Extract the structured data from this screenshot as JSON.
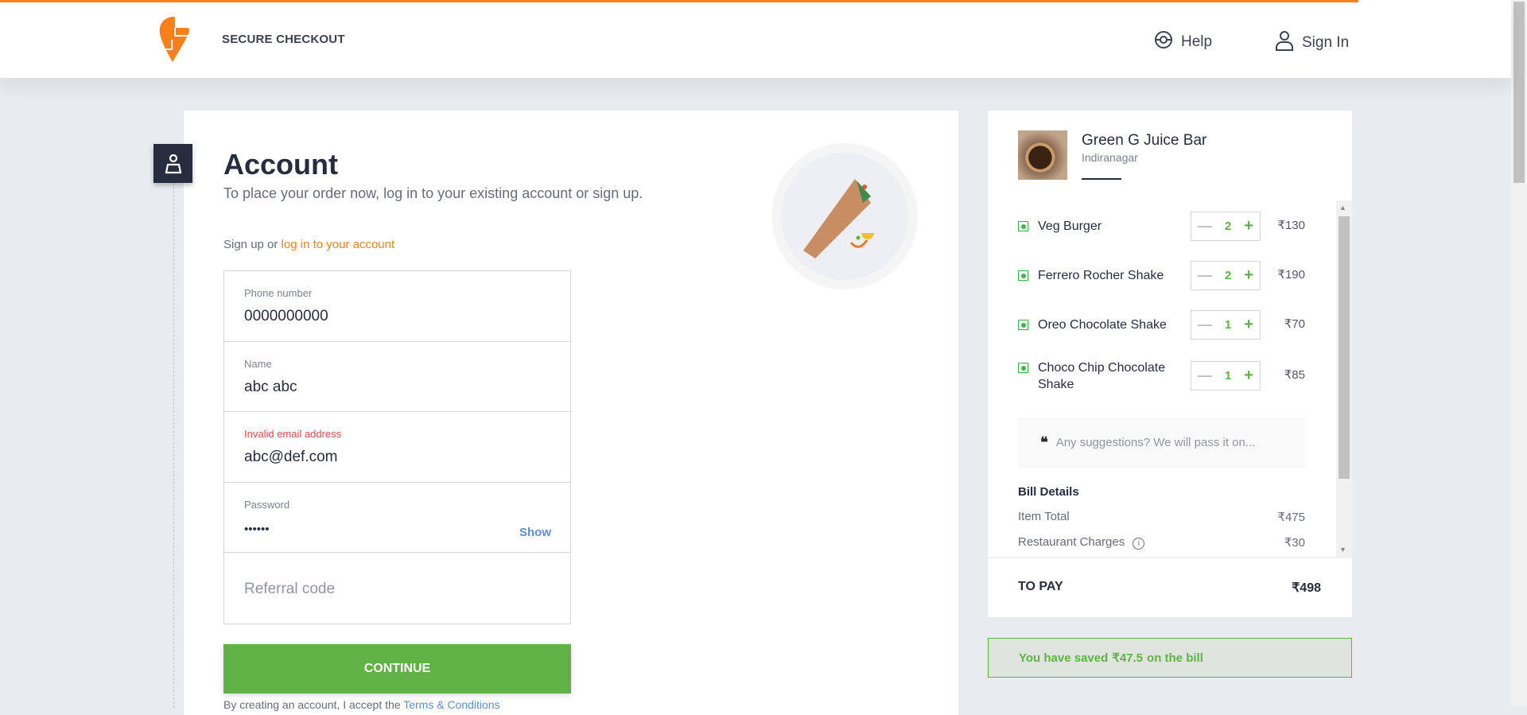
{
  "header": {
    "brand": "SECURE CHECKOUT",
    "help": "Help",
    "sign_in": "Sign In"
  },
  "account": {
    "title": "Account",
    "subtitle": "To place your order now, log in to your existing account or sign up.",
    "signup_prefix": "Sign up or ",
    "login_link": "log in to your account",
    "fields": [
      {
        "label": "Phone number",
        "value": "0000000000"
      },
      {
        "label": "Name",
        "value": "abc abc"
      },
      {
        "label": "Invalid email address",
        "value": "abc@def.com"
      },
      {
        "label": "Password",
        "value": "••••••",
        "toggle": "Show"
      },
      {
        "placeholder": "Referral code"
      }
    ],
    "continue": "CONTINUE",
    "terms_prefix": "By creating an account, I accept the ",
    "terms_link": "Terms & Conditions"
  },
  "cart": {
    "restaurant": "Green G Juice Bar",
    "location": "Indiranagar",
    "items": [
      {
        "name": "Veg Burger",
        "qty": "2",
        "price": "₹130"
      },
      {
        "name": "Ferrero Rocher Shake",
        "qty": "2",
        "price": "₹190"
      },
      {
        "name": "Oreo Chocolate Shake",
        "qty": "1",
        "price": "₹70"
      },
      {
        "name": "Choco Chip Chocolate Shake",
        "qty": "1",
        "price": "₹85"
      }
    ],
    "suggestions_placeholder": "Any suggestions? We will pass it on...",
    "bill_title": "Bill Details",
    "bill": [
      {
        "label": "Item Total",
        "value": "₹475"
      },
      {
        "label": "Restaurant Charges",
        "value": "₹30"
      }
    ],
    "to_pay_label": "TO PAY",
    "to_pay_value": "₹498",
    "saved_prefix": "You have saved",
    "saved_amount": "₹47.5",
    "saved_suffix": "on the bill"
  },
  "colors": {
    "brand": "#fc8019",
    "green": "#60b246",
    "dark": "#282c3f",
    "link": "#5d8ed5",
    "error": "#e44c4c"
  }
}
